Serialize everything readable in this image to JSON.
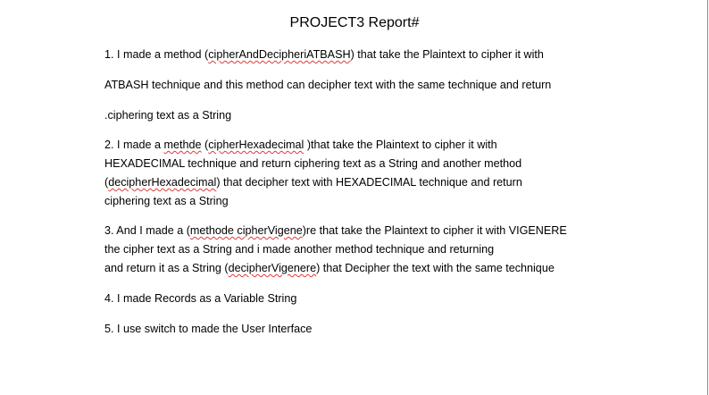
{
  "title": "PROJECT3  Report#",
  "item1": {
    "line1_a": "1. I made a method (",
    "line1_term": "cipherAndDecipheriATBASH",
    "line1_b": ") that take the Plaintext to cipher it with",
    "line2": "ATBASH technique and this method can decipher text with the same technique and return",
    "line3": ".ciphering text as a String"
  },
  "item2": {
    "line1_a": "2. I made a ",
    "line1_term1": "methde",
    "line1_b": " (",
    "line1_term2": "cipherHexadecimal",
    "line1_c": " )that take the Plaintext to cipher it  with",
    "line2": "HEXADECIMAL technique and return ciphering text as a  String and another method",
    "line3_a": "(",
    "line3_term": "decipherHexadecimal",
    "line3_b": ") that decipher text with HEXADECIMAL technique and return",
    "line4": "ciphering text as a String"
  },
  "item3": {
    "line1_a": "3. And I made a (",
    "line1_term": "methode cipherVigene",
    "line1_b": ")re that take the Plaintext to cipher it with VIGENERE",
    "line2": "the cipher text as a String and i made another method  technique and returning",
    "line3_a": "and return it  as a String (",
    "line3_term": "decipherVigenere",
    "line3_b": ") that Decipher the text with the same technique"
  },
  "item4": "4. I made Records as a Variable String",
  "item5": "5.  I use switch to made the User Interface"
}
